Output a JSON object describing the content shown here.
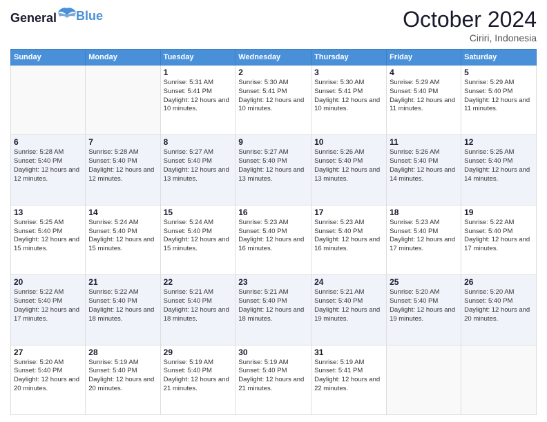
{
  "header": {
    "logo_line1": "General",
    "logo_line2": "Blue",
    "month": "October 2024",
    "location": "Ciriri, Indonesia"
  },
  "days_of_week": [
    "Sunday",
    "Monday",
    "Tuesday",
    "Wednesday",
    "Thursday",
    "Friday",
    "Saturday"
  ],
  "weeks": [
    [
      {
        "day": "",
        "info": ""
      },
      {
        "day": "",
        "info": ""
      },
      {
        "day": "1",
        "info": "Sunrise: 5:31 AM\nSunset: 5:41 PM\nDaylight: 12 hours and 10 minutes."
      },
      {
        "day": "2",
        "info": "Sunrise: 5:30 AM\nSunset: 5:41 PM\nDaylight: 12 hours and 10 minutes."
      },
      {
        "day": "3",
        "info": "Sunrise: 5:30 AM\nSunset: 5:41 PM\nDaylight: 12 hours and 10 minutes."
      },
      {
        "day": "4",
        "info": "Sunrise: 5:29 AM\nSunset: 5:40 PM\nDaylight: 12 hours and 11 minutes."
      },
      {
        "day": "5",
        "info": "Sunrise: 5:29 AM\nSunset: 5:40 PM\nDaylight: 12 hours and 11 minutes."
      }
    ],
    [
      {
        "day": "6",
        "info": "Sunrise: 5:28 AM\nSunset: 5:40 PM\nDaylight: 12 hours and 12 minutes."
      },
      {
        "day": "7",
        "info": "Sunrise: 5:28 AM\nSunset: 5:40 PM\nDaylight: 12 hours and 12 minutes."
      },
      {
        "day": "8",
        "info": "Sunrise: 5:27 AM\nSunset: 5:40 PM\nDaylight: 12 hours and 13 minutes."
      },
      {
        "day": "9",
        "info": "Sunrise: 5:27 AM\nSunset: 5:40 PM\nDaylight: 12 hours and 13 minutes."
      },
      {
        "day": "10",
        "info": "Sunrise: 5:26 AM\nSunset: 5:40 PM\nDaylight: 12 hours and 13 minutes."
      },
      {
        "day": "11",
        "info": "Sunrise: 5:26 AM\nSunset: 5:40 PM\nDaylight: 12 hours and 14 minutes."
      },
      {
        "day": "12",
        "info": "Sunrise: 5:25 AM\nSunset: 5:40 PM\nDaylight: 12 hours and 14 minutes."
      }
    ],
    [
      {
        "day": "13",
        "info": "Sunrise: 5:25 AM\nSunset: 5:40 PM\nDaylight: 12 hours and 15 minutes."
      },
      {
        "day": "14",
        "info": "Sunrise: 5:24 AM\nSunset: 5:40 PM\nDaylight: 12 hours and 15 minutes."
      },
      {
        "day": "15",
        "info": "Sunrise: 5:24 AM\nSunset: 5:40 PM\nDaylight: 12 hours and 15 minutes."
      },
      {
        "day": "16",
        "info": "Sunrise: 5:23 AM\nSunset: 5:40 PM\nDaylight: 12 hours and 16 minutes."
      },
      {
        "day": "17",
        "info": "Sunrise: 5:23 AM\nSunset: 5:40 PM\nDaylight: 12 hours and 16 minutes."
      },
      {
        "day": "18",
        "info": "Sunrise: 5:23 AM\nSunset: 5:40 PM\nDaylight: 12 hours and 17 minutes."
      },
      {
        "day": "19",
        "info": "Sunrise: 5:22 AM\nSunset: 5:40 PM\nDaylight: 12 hours and 17 minutes."
      }
    ],
    [
      {
        "day": "20",
        "info": "Sunrise: 5:22 AM\nSunset: 5:40 PM\nDaylight: 12 hours and 17 minutes."
      },
      {
        "day": "21",
        "info": "Sunrise: 5:22 AM\nSunset: 5:40 PM\nDaylight: 12 hours and 18 minutes."
      },
      {
        "day": "22",
        "info": "Sunrise: 5:21 AM\nSunset: 5:40 PM\nDaylight: 12 hours and 18 minutes."
      },
      {
        "day": "23",
        "info": "Sunrise: 5:21 AM\nSunset: 5:40 PM\nDaylight: 12 hours and 18 minutes."
      },
      {
        "day": "24",
        "info": "Sunrise: 5:21 AM\nSunset: 5:40 PM\nDaylight: 12 hours and 19 minutes."
      },
      {
        "day": "25",
        "info": "Sunrise: 5:20 AM\nSunset: 5:40 PM\nDaylight: 12 hours and 19 minutes."
      },
      {
        "day": "26",
        "info": "Sunrise: 5:20 AM\nSunset: 5:40 PM\nDaylight: 12 hours and 20 minutes."
      }
    ],
    [
      {
        "day": "27",
        "info": "Sunrise: 5:20 AM\nSunset: 5:40 PM\nDaylight: 12 hours and 20 minutes."
      },
      {
        "day": "28",
        "info": "Sunrise: 5:19 AM\nSunset: 5:40 PM\nDaylight: 12 hours and 20 minutes."
      },
      {
        "day": "29",
        "info": "Sunrise: 5:19 AM\nSunset: 5:40 PM\nDaylight: 12 hours and 21 minutes."
      },
      {
        "day": "30",
        "info": "Sunrise: 5:19 AM\nSunset: 5:40 PM\nDaylight: 12 hours and 21 minutes."
      },
      {
        "day": "31",
        "info": "Sunrise: 5:19 AM\nSunset: 5:41 PM\nDaylight: 12 hours and 22 minutes."
      },
      {
        "day": "",
        "info": ""
      },
      {
        "day": "",
        "info": ""
      }
    ]
  ]
}
